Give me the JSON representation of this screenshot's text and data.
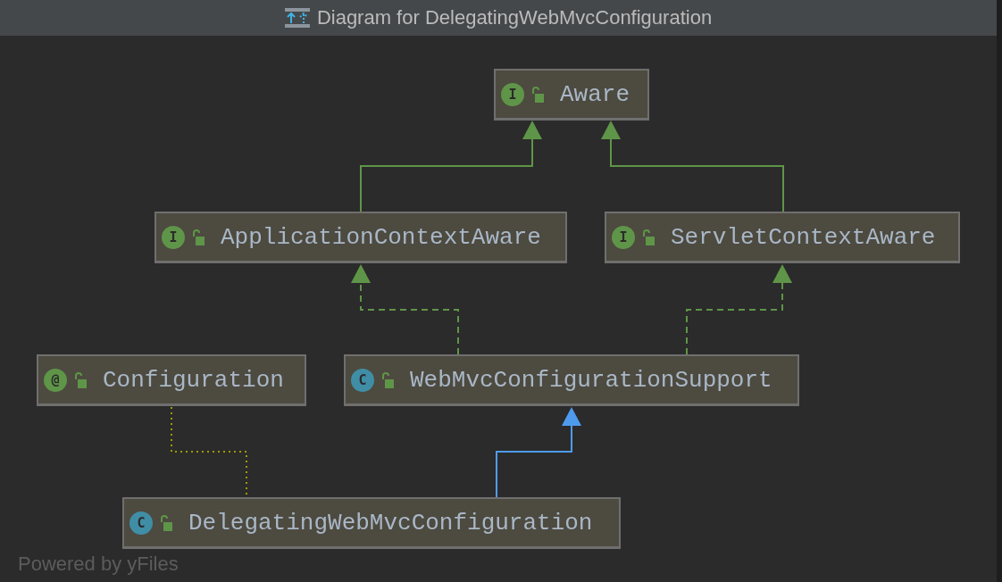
{
  "window": {
    "title": "Diagram for DelegatingWebMvcConfiguration"
  },
  "nodes": [
    {
      "name": "Aware",
      "kind": "interface",
      "badge": "I"
    },
    {
      "name": "ApplicationContextAware",
      "kind": "interface",
      "badge": "I"
    },
    {
      "name": "ServletContextAware",
      "kind": "interface",
      "badge": "I"
    },
    {
      "name": "Configuration",
      "kind": "annotation",
      "badge": "@"
    },
    {
      "name": "WebMvcConfigurationSupport",
      "kind": "class",
      "badge": "C"
    },
    {
      "name": "DelegatingWebMvcConfiguration",
      "kind": "class",
      "badge": "C"
    }
  ],
  "edges": [
    {
      "kind": "extends-interface"
    },
    {
      "kind": "extends-interface"
    },
    {
      "kind": "implements"
    },
    {
      "kind": "implements"
    },
    {
      "kind": "annotated"
    },
    {
      "kind": "extends"
    }
  ],
  "footer": "Powered by yFiles"
}
